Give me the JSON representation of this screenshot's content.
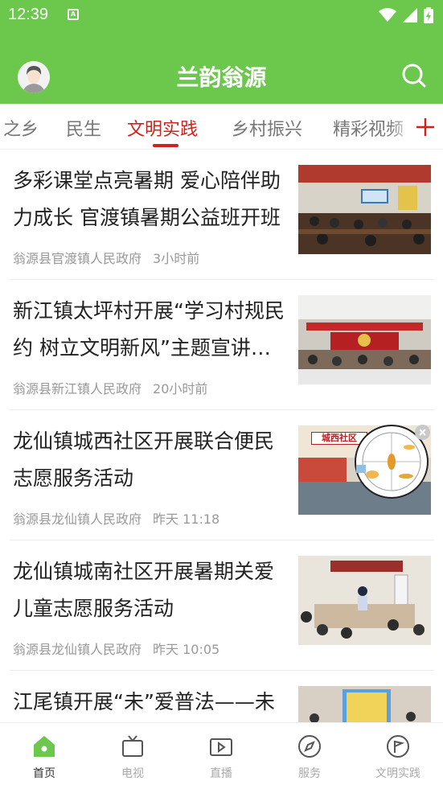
{
  "status_bar": {
    "time": "12:39",
    "sim_label": "A"
  },
  "app": {
    "title": "兰韵翁源",
    "brand_color": "#6bc84c",
    "accent_color": "#d0211c"
  },
  "tabs": [
    {
      "label": "之乡",
      "active": false
    },
    {
      "label": "民生",
      "active": false
    },
    {
      "label": "文明实践",
      "active": true
    },
    {
      "label": "乡村振兴",
      "active": false
    },
    {
      "label": "精彩视频",
      "active": false
    }
  ],
  "feed": [
    {
      "title": "多彩课堂点亮暑期 爱心陪伴助力成长 官渡镇暑期公益班开班",
      "source": "翁源县官渡镇人民政府",
      "time": "3小时前"
    },
    {
      "title": "新江镇太坪村开展“学习村规民约 树立文明新风”主题宣讲活动",
      "source": "翁源县新江镇人民政府",
      "time": "20小时前"
    },
    {
      "title": "龙仙镇城西社区开展联合便民志愿服务活动",
      "source": "翁源县龙仙镇人民政府",
      "time": "昨天 11:18"
    },
    {
      "title": "龙仙镇城南社区开展暑期关爱儿童志愿服务活动",
      "source": "翁源县龙仙镇人民政府",
      "time": "昨天 10:05"
    },
    {
      "title": "江尾镇开展“未”爱普法——未",
      "source": "",
      "time": ""
    }
  ],
  "thumb_banner_text": "城西社区",
  "bottom_nav": [
    {
      "label": "首页",
      "icon": "home-icon",
      "active": true
    },
    {
      "label": "电视",
      "icon": "tv-icon",
      "active": false
    },
    {
      "label": "直播",
      "icon": "live-video-icon",
      "active": false
    },
    {
      "label": "服务",
      "icon": "compass-icon",
      "active": false
    },
    {
      "label": "文明实践",
      "icon": "flag-badge-icon",
      "active": false
    }
  ]
}
